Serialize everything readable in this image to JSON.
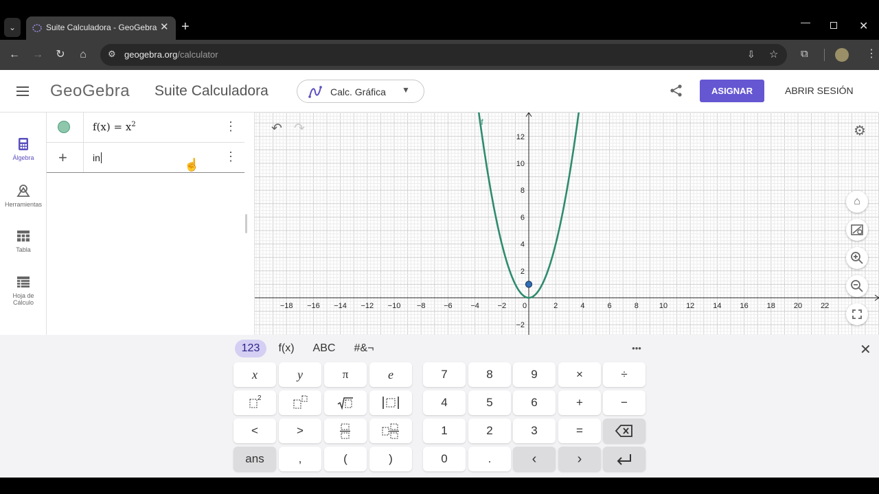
{
  "browser": {
    "tab_title": "Suite Calculadora - GeoGebra",
    "url_host": "geogebra.org",
    "url_path": "/calculator"
  },
  "header": {
    "logo": "GeoGebra",
    "app_title": "Suite Calculadora",
    "app_selector": "Calc. Gráfica",
    "assign_button": "ASIGNAR",
    "login": "ABRIR SESIÓN",
    "accent_color": "#6557d2"
  },
  "sidebar": {
    "items": [
      {
        "label": "Álgebra",
        "icon": "calculator-icon"
      },
      {
        "label": "Herramientas",
        "icon": "tools-icon"
      },
      {
        "label": "Tabla",
        "icon": "table-icon"
      },
      {
        "label": "Hoja de Cálculo",
        "icon": "spreadsheet-icon"
      }
    ]
  },
  "algebra": {
    "row1_fname": "f(x)",
    "row1_eq": "=",
    "row1_base": "x",
    "row1_exp": "2",
    "row2_input": "in"
  },
  "graph": {
    "function_label": "f",
    "x_ticks": [
      "−18",
      "−16",
      "−14",
      "−12",
      "−10",
      "−8",
      "−6",
      "−4",
      "−2",
      "0",
      "2",
      "4",
      "6",
      "8",
      "10",
      "12",
      "14",
      "16",
      "18",
      "20",
      "22"
    ],
    "y_ticks": [
      "12",
      "10",
      "8",
      "6",
      "4",
      "2",
      "−2"
    ],
    "curve_color": "#2e8b6e"
  },
  "keyboard": {
    "tabs": [
      "123",
      "f(x)",
      "ABC",
      "#&¬"
    ],
    "more": "•••",
    "row1": [
      "x",
      "y",
      "π",
      "e",
      "7",
      "8",
      "9",
      "×",
      "÷"
    ],
    "row2": [
      "4",
      "5",
      "6",
      "+",
      "−"
    ],
    "row3": [
      "<",
      ">",
      "1",
      "2",
      "3",
      "="
    ],
    "row4": [
      "ans",
      ",",
      "(",
      ")",
      "0",
      "."
    ]
  }
}
